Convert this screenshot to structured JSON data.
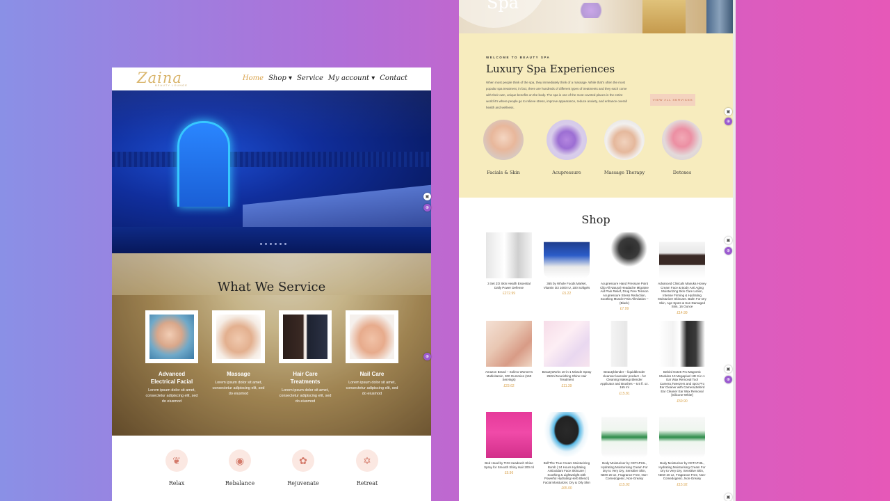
{
  "left_site": {
    "logo": "Zaina",
    "logo_sub": "BEAUTY LOUNGE",
    "nav": [
      {
        "label": "Home",
        "active": true
      },
      {
        "label": "Shop ▾",
        "active": false
      },
      {
        "label": "Service",
        "active": false
      },
      {
        "label": "My account ▾",
        "active": false
      },
      {
        "label": "Contact",
        "active": false
      }
    ],
    "services_title": "What We Service",
    "services": [
      {
        "name": "Advanced Electrical Facial",
        "desc": "Lorem ipsum dolor sit amet, consectetur adipiscing elit, sed do eiusmod"
      },
      {
        "name": "Massage",
        "desc": "Lorem ipsum dolor sit amet, consectetur adipiscing elit, sed do eiusmod"
      },
      {
        "name": "Hair Care Treatments",
        "desc": "Lorem ipsum dolor sit amet, consectetur adipiscing elit, sed do eiusmod"
      },
      {
        "name": "Nail Care",
        "desc": "Lorem ipsum dolor sit amet, consectetur adipiscing elit, sed do eiusmod"
      }
    ],
    "features": [
      {
        "label": "Relax",
        "icon": "leaf-icon",
        "glyph": "❦"
      },
      {
        "label": "Rebalance",
        "icon": "balance-icon",
        "glyph": "◉"
      },
      {
        "label": "Rejuvenate",
        "icon": "flower-icon",
        "glyph": "✿"
      },
      {
        "label": "Retreat",
        "icon": "star-icon",
        "glyph": "✡"
      }
    ]
  },
  "right_site": {
    "banner_word": "Spa",
    "kicker": "WELCOME TO BEAUTY SPA",
    "title": "Luxury Spa Experiences",
    "body": "When most people think of the spa, they immediately think of a massage. While that's often the most popular spa treatment, in fact, there are hundreds of different types of treatments and they each come with their own, unique benefits on the body. The spa is one of the most coveted places in the entire world it's where people go to relieve stress, improve appearance, reduce anxiety, and enhance overall health and wellness.",
    "button": "VIEW ALL SERVICES",
    "treatments": [
      {
        "label": "Facials & Skin"
      },
      {
        "label": "Acupressure"
      },
      {
        "label": "Massage Therapy"
      },
      {
        "label": "Detoxes"
      }
    ],
    "shop_title": "Shop",
    "products": [
      {
        "name": "3 Set ZO Skin Health Essential Daily Power Defense",
        "price": "£272.99"
      },
      {
        "name": "365 by Whole Foods Market, Vitamin D3 1000 IU, 100 Softgels",
        "price": "£5.22"
      },
      {
        "name": "Acupressure Hand Pressure Point Clip All Natural Headache Migraine Aid Pain Relief, Drug Free Tension Acupressure Stress Reduction, Soothing Muscle Pain Alleviation – (Black)",
        "price": "£7.99"
      },
      {
        "name": "Advanced Clinicals Manuka Honey Cream Face & Body Anti Aging Moisturizing Skin Care Lotion, Intense Firming & Hydrating Moisturizer Skincare. Balm For Dry Skin, Age Spots & Sun Damaged Skin, 16 Ounce",
        "price": "£14.99"
      },
      {
        "name": "Amazon Brand – Solimo Women's Multivitamin, 300 Gummies (150 Servings)",
        "price": "£23.62"
      },
      {
        "name": "BeautyWorks 10-in-1 Miracle Spray 250ml Nourishing Shine Hair Treatment",
        "price": "£11.39"
      },
      {
        "name": "Beautyblender – liquidblender cleanser lavender product – for Cleaning Makeup Blender Applicator and Brushes – 6.5 fl. oz. 165 ml",
        "price": "£15.81"
      },
      {
        "name": "Bebird Note5 Pro Magnetic Modules 10 Megapixel HD 3-in-1 Ear Wax Removal Tool Camera,Tweezers and 4pcs Pro Ear Cleaner with Camera,Bebird Ear Cleaner Ear Wax Removal [Silicone-White]",
        "price": "£59.90"
      },
      {
        "name": "Bed Head by TIGI Headrush Shine Spray for Smooth Shiny Hair 200 ml",
        "price": "£9.96"
      },
      {
        "name": "Bell'The True Cream Moisturizing Bomb | 24 Hours Hydrating Antioxidant Face Skincare | Soothing & Lightweight with Powerful Hydrating Herb Blend | Facial Moisturizer, Dry & Oily Skin",
        "price": "£65.00"
      },
      {
        "name": "Body Moisturiser by CETAPHIL, Hydrating Moisturising Cream For Dry to Very Dry, Sensitive Skin, NEW 20 oz, Fragrance Free, Non-Comedogenic, Non-Greasy",
        "price": "£15.92"
      },
      {
        "name": "Body Moisturiser by CETAPHIL, Hydrating Moisturising Cream For Dry to Very Dry, Sensitive Skin, NEW 20 oz, Fragrance Free, Non-Comedogenic, Non-Greasy",
        "price": "£15.92"
      }
    ]
  },
  "colors": {
    "gold": "#d9a24a",
    "cream": "#f7ecbe",
    "peach_button": "#f4d3bf"
  }
}
